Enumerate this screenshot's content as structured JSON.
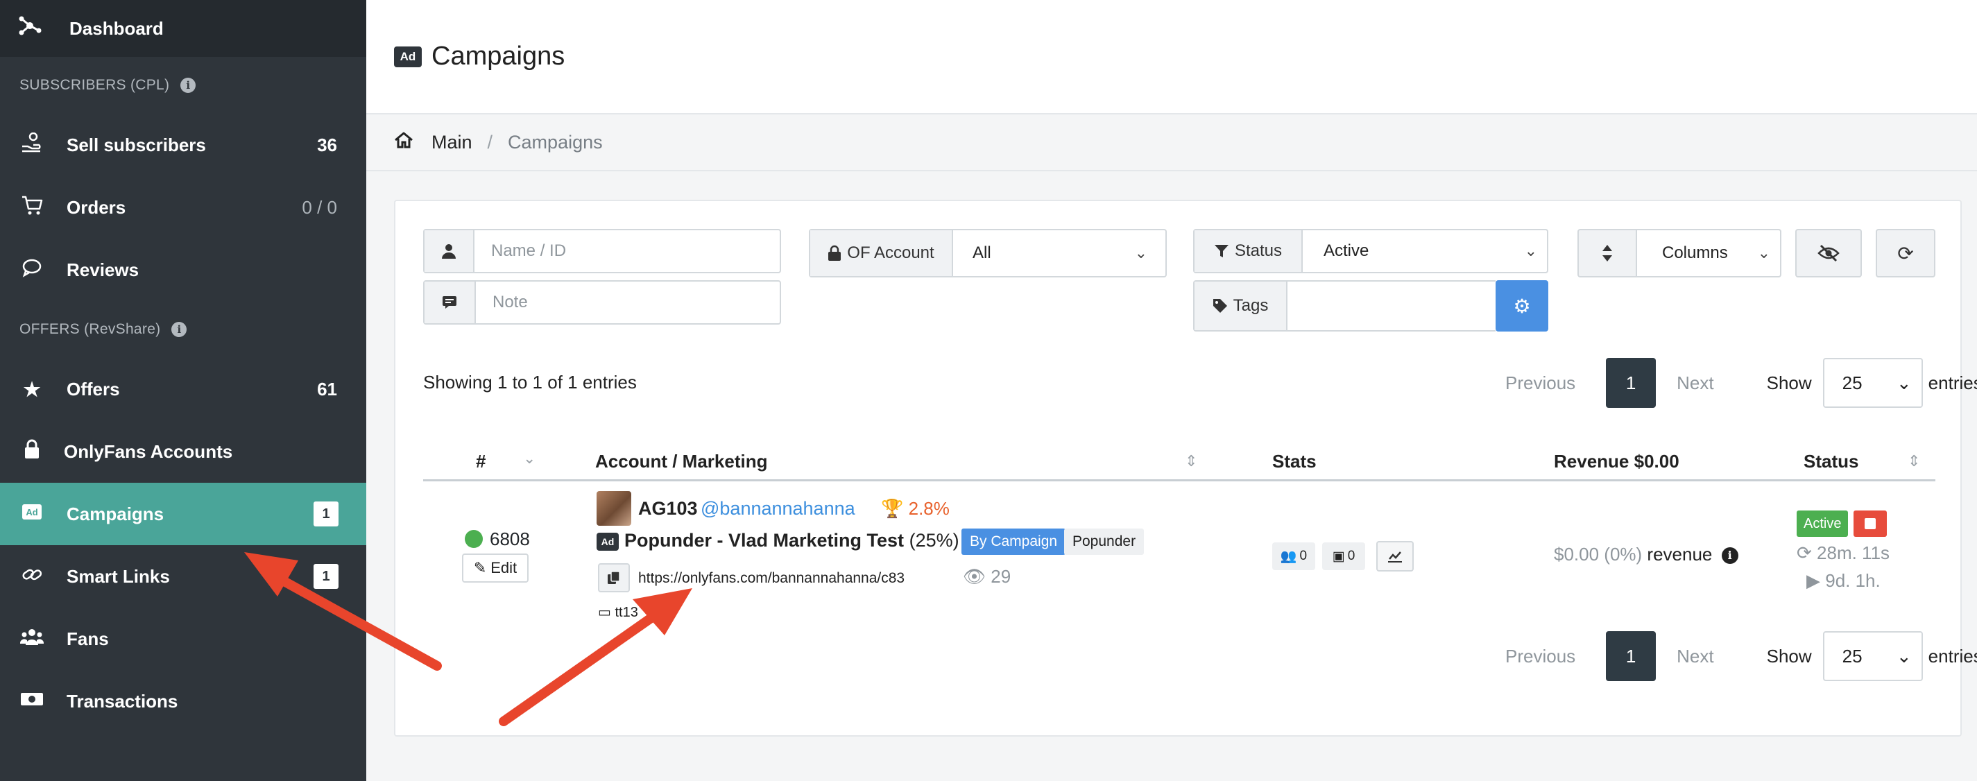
{
  "sidebar": {
    "top": {
      "label": "Dashboard"
    },
    "section1": {
      "label": "SUBSCRIBERS (CPL)"
    },
    "section2": {
      "label": "OFFERS (RevShare)"
    },
    "items": [
      {
        "label": "Sell subscribers",
        "count": "36"
      },
      {
        "label": "Orders",
        "count_a": "0",
        "count_sep": " / ",
        "count_b": "0"
      },
      {
        "label": "Reviews"
      },
      {
        "label": "Offers",
        "count": "61"
      },
      {
        "label": "OnlyFans Accounts"
      },
      {
        "label": "Campaigns",
        "badge": "1"
      },
      {
        "label": "Smart Links",
        "badge": "1"
      },
      {
        "label": "Fans"
      },
      {
        "label": "Transactions"
      }
    ]
  },
  "header": {
    "badge": "Ad",
    "title": "Campaigns"
  },
  "breadcrumb": {
    "main": "Main",
    "sep": "/",
    "current": "Campaigns"
  },
  "filters": {
    "name_placeholder": "Name / ID",
    "note_placeholder": "Note",
    "of_account_label": "OF Account",
    "of_account_value": "All",
    "status_label": "Status",
    "status_value": "Active",
    "tags_label": "Tags",
    "columns_label": "Columns"
  },
  "table_info": {
    "showing": "Showing 1 to 1 of 1 entries"
  },
  "pagination": {
    "previous": "Previous",
    "page": "1",
    "next": "Next",
    "show": "Show",
    "page_size": "25",
    "entries": "entries"
  },
  "columns": {
    "num": "#",
    "account": "Account / Marketing",
    "stats": "Stats",
    "revenue": "Revenue $0.00",
    "status": "Status"
  },
  "row": {
    "id": "6808",
    "edit": "Edit",
    "account": "AG103",
    "handle": "@bannannahanna",
    "rate": "2.8%",
    "campaign_badge": "Ad",
    "campaign_name": "Popunder - Vlad Marketing Test",
    "campaign_share": "(25%)",
    "tag1": "By Campaign",
    "tag2": "Popunder",
    "url": "https://onlyfans.com/bannannahanna/c83",
    "views": "29",
    "note": "tt13",
    "stat_subs": "0",
    "stat_money": "0",
    "revenue_amount": "$0.00 (0%)",
    "revenue_label": "revenue",
    "status_badge": "Active",
    "status_time1": "28m. 11s",
    "status_time2": "9d. 1h."
  },
  "colors": {
    "sidebar_bg": "#2f353b",
    "active_item": "#4aa599",
    "link_blue": "#3d8fde",
    "success": "#4caf50",
    "danger": "#e74c3c",
    "annotation_arrow": "#e8452c"
  }
}
